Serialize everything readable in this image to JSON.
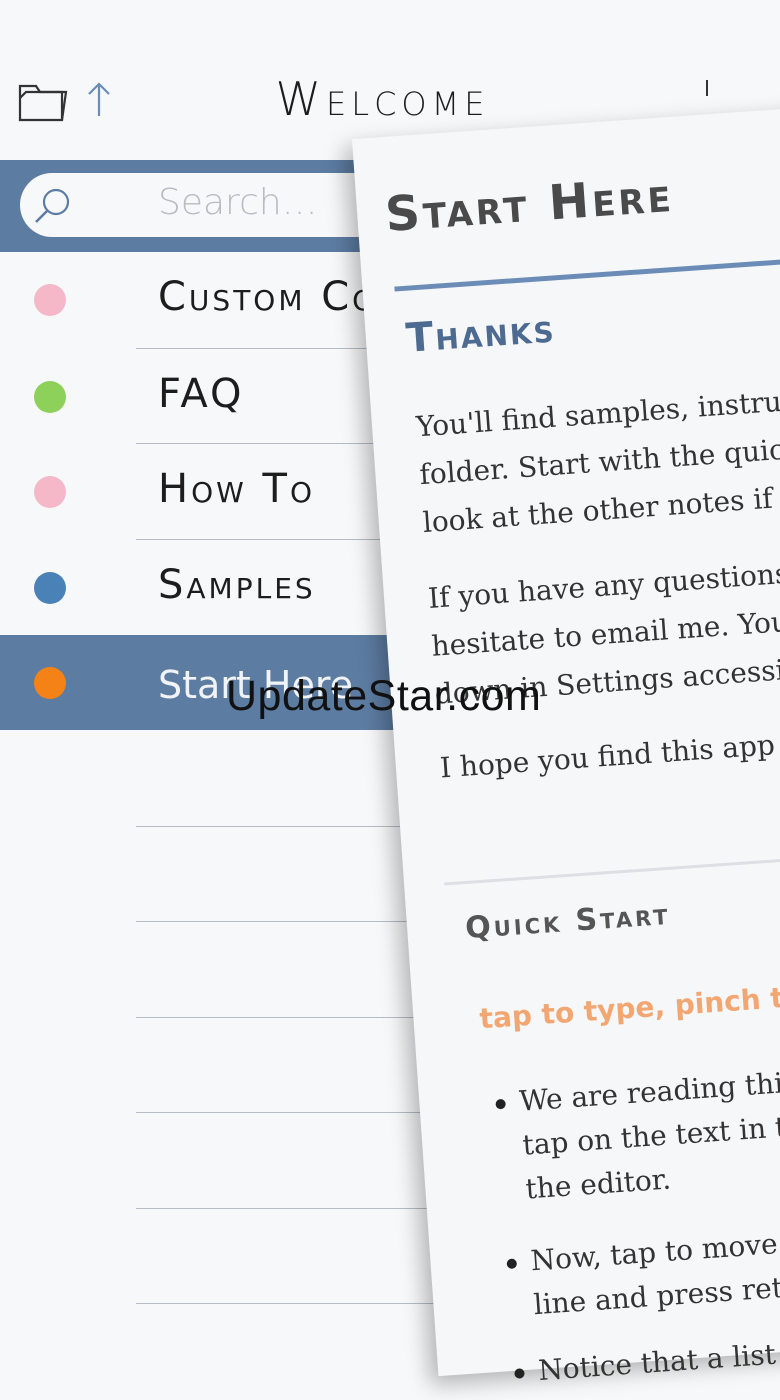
{
  "header": {
    "title": "Welcome",
    "folder_icon": "folder-icon",
    "up_icon": "arrow-up-icon"
  },
  "search": {
    "placeholder": "Search…",
    "icon": "search-icon",
    "bar_color": "#5d7ca2"
  },
  "list": {
    "items": [
      {
        "label": "Custom Co",
        "color": "#f5b8c8",
        "selected": false
      },
      {
        "label": "FAQ",
        "color": "#8dd15a",
        "selected": false
      },
      {
        "label": "How To",
        "color": "#f5b8c8",
        "selected": false
      },
      {
        "label": "Samples",
        "color": "#4a82b8",
        "selected": false
      },
      {
        "label": "Start Here",
        "color": "#f58217",
        "selected": true
      }
    ]
  },
  "watermark": "UpdateStar.com",
  "preview": {
    "title": "Start Here",
    "section_title": "Thanks",
    "paragraph1": [
      "You'll find samples, instruction",
      "folder. Start with the quick-sta",
      "look at the other notes if you'c"
    ],
    "paragraph2": [
      "If you have any questions or c",
      "hesitate to email me. You'll fi",
      "down in Settings accessible f"
    ],
    "paragraph3": "I hope you find this app use",
    "quick_start_title": "Quick Start",
    "hint": "tap to type, pinch to previ",
    "bullets": [
      [
        "We are reading this no",
        "tap on the text in this",
        "the editor."
      ],
      [
        "Now, tap to move th",
        "line and press returr"
      ],
      [
        "Notice that a list ite"
      ]
    ],
    "accent_color": "#6a8cb7",
    "hint_color": "#f2a672"
  }
}
